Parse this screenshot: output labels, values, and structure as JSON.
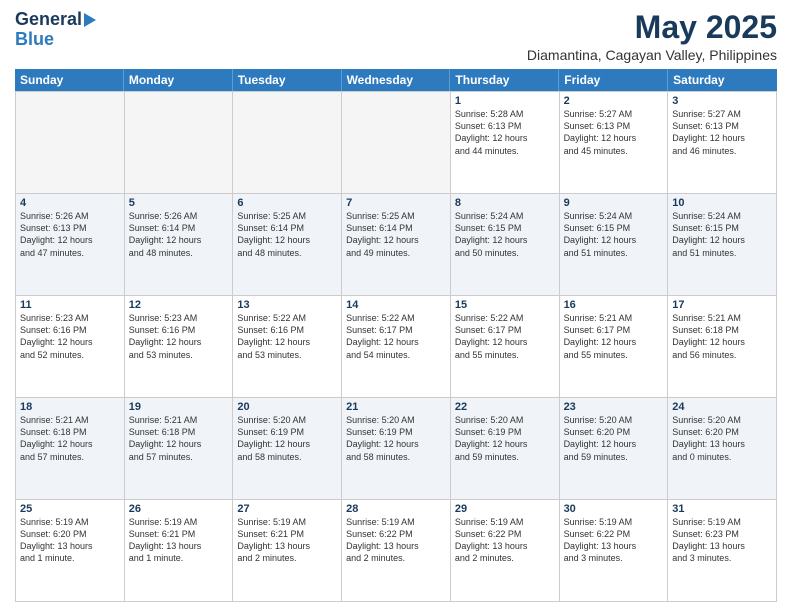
{
  "logo": {
    "line1": "General",
    "line2": "Blue"
  },
  "title": {
    "month_year": "May 2025",
    "location": "Diamantina, Cagayan Valley, Philippines"
  },
  "header_days": [
    "Sunday",
    "Monday",
    "Tuesday",
    "Wednesday",
    "Thursday",
    "Friday",
    "Saturday"
  ],
  "weeks": [
    [
      {
        "day": "",
        "text": "",
        "empty": true
      },
      {
        "day": "",
        "text": "",
        "empty": true
      },
      {
        "day": "",
        "text": "",
        "empty": true
      },
      {
        "day": "",
        "text": "",
        "empty": true
      },
      {
        "day": "1",
        "text": "Sunrise: 5:28 AM\nSunset: 6:13 PM\nDaylight: 12 hours\nand 44 minutes.",
        "shade": false
      },
      {
        "day": "2",
        "text": "Sunrise: 5:27 AM\nSunset: 6:13 PM\nDaylight: 12 hours\nand 45 minutes.",
        "shade": false
      },
      {
        "day": "3",
        "text": "Sunrise: 5:27 AM\nSunset: 6:13 PM\nDaylight: 12 hours\nand 46 minutes.",
        "shade": false
      }
    ],
    [
      {
        "day": "4",
        "text": "Sunrise: 5:26 AM\nSunset: 6:13 PM\nDaylight: 12 hours\nand 47 minutes.",
        "shade": true
      },
      {
        "day": "5",
        "text": "Sunrise: 5:26 AM\nSunset: 6:14 PM\nDaylight: 12 hours\nand 48 minutes.",
        "shade": true
      },
      {
        "day": "6",
        "text": "Sunrise: 5:25 AM\nSunset: 6:14 PM\nDaylight: 12 hours\nand 48 minutes.",
        "shade": true
      },
      {
        "day": "7",
        "text": "Sunrise: 5:25 AM\nSunset: 6:14 PM\nDaylight: 12 hours\nand 49 minutes.",
        "shade": true
      },
      {
        "day": "8",
        "text": "Sunrise: 5:24 AM\nSunset: 6:15 PM\nDaylight: 12 hours\nand 50 minutes.",
        "shade": true
      },
      {
        "day": "9",
        "text": "Sunrise: 5:24 AM\nSunset: 6:15 PM\nDaylight: 12 hours\nand 51 minutes.",
        "shade": true
      },
      {
        "day": "10",
        "text": "Sunrise: 5:24 AM\nSunset: 6:15 PM\nDaylight: 12 hours\nand 51 minutes.",
        "shade": true
      }
    ],
    [
      {
        "day": "11",
        "text": "Sunrise: 5:23 AM\nSunset: 6:16 PM\nDaylight: 12 hours\nand 52 minutes.",
        "shade": false
      },
      {
        "day": "12",
        "text": "Sunrise: 5:23 AM\nSunset: 6:16 PM\nDaylight: 12 hours\nand 53 minutes.",
        "shade": false
      },
      {
        "day": "13",
        "text": "Sunrise: 5:22 AM\nSunset: 6:16 PM\nDaylight: 12 hours\nand 53 minutes.",
        "shade": false
      },
      {
        "day": "14",
        "text": "Sunrise: 5:22 AM\nSunset: 6:17 PM\nDaylight: 12 hours\nand 54 minutes.",
        "shade": false
      },
      {
        "day": "15",
        "text": "Sunrise: 5:22 AM\nSunset: 6:17 PM\nDaylight: 12 hours\nand 55 minutes.",
        "shade": false
      },
      {
        "day": "16",
        "text": "Sunrise: 5:21 AM\nSunset: 6:17 PM\nDaylight: 12 hours\nand 55 minutes.",
        "shade": false
      },
      {
        "day": "17",
        "text": "Sunrise: 5:21 AM\nSunset: 6:18 PM\nDaylight: 12 hours\nand 56 minutes.",
        "shade": false
      }
    ],
    [
      {
        "day": "18",
        "text": "Sunrise: 5:21 AM\nSunset: 6:18 PM\nDaylight: 12 hours\nand 57 minutes.",
        "shade": true
      },
      {
        "day": "19",
        "text": "Sunrise: 5:21 AM\nSunset: 6:18 PM\nDaylight: 12 hours\nand 57 minutes.",
        "shade": true
      },
      {
        "day": "20",
        "text": "Sunrise: 5:20 AM\nSunset: 6:19 PM\nDaylight: 12 hours\nand 58 minutes.",
        "shade": true
      },
      {
        "day": "21",
        "text": "Sunrise: 5:20 AM\nSunset: 6:19 PM\nDaylight: 12 hours\nand 58 minutes.",
        "shade": true
      },
      {
        "day": "22",
        "text": "Sunrise: 5:20 AM\nSunset: 6:19 PM\nDaylight: 12 hours\nand 59 minutes.",
        "shade": true
      },
      {
        "day": "23",
        "text": "Sunrise: 5:20 AM\nSunset: 6:20 PM\nDaylight: 12 hours\nand 59 minutes.",
        "shade": true
      },
      {
        "day": "24",
        "text": "Sunrise: 5:20 AM\nSunset: 6:20 PM\nDaylight: 13 hours\nand 0 minutes.",
        "shade": true
      }
    ],
    [
      {
        "day": "25",
        "text": "Sunrise: 5:19 AM\nSunset: 6:20 PM\nDaylight: 13 hours\nand 1 minute.",
        "shade": false
      },
      {
        "day": "26",
        "text": "Sunrise: 5:19 AM\nSunset: 6:21 PM\nDaylight: 13 hours\nand 1 minute.",
        "shade": false
      },
      {
        "day": "27",
        "text": "Sunrise: 5:19 AM\nSunset: 6:21 PM\nDaylight: 13 hours\nand 2 minutes.",
        "shade": false
      },
      {
        "day": "28",
        "text": "Sunrise: 5:19 AM\nSunset: 6:22 PM\nDaylight: 13 hours\nand 2 minutes.",
        "shade": false
      },
      {
        "day": "29",
        "text": "Sunrise: 5:19 AM\nSunset: 6:22 PM\nDaylight: 13 hours\nand 2 minutes.",
        "shade": false
      },
      {
        "day": "30",
        "text": "Sunrise: 5:19 AM\nSunset: 6:22 PM\nDaylight: 13 hours\nand 3 minutes.",
        "shade": false
      },
      {
        "day": "31",
        "text": "Sunrise: 5:19 AM\nSunset: 6:23 PM\nDaylight: 13 hours\nand 3 minutes.",
        "shade": false
      }
    ]
  ]
}
